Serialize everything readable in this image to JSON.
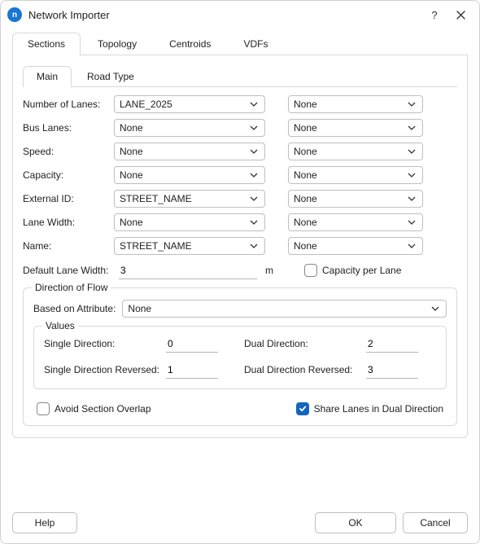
{
  "window": {
    "title": "Network Importer",
    "app_icon_letter": "n"
  },
  "tabs": {
    "items": [
      "Sections",
      "Topology",
      "Centroids",
      "VDFs"
    ],
    "active_index": 0
  },
  "subtabs": {
    "items": [
      "Main",
      "Road Type"
    ],
    "active_index": 0
  },
  "fields": [
    {
      "label": "Number of Lanes:",
      "left": "LANE_2025",
      "right": "None"
    },
    {
      "label": "Bus Lanes:",
      "left": "None",
      "right": "None"
    },
    {
      "label": "Speed:",
      "left": "None",
      "right": "None"
    },
    {
      "label": "Capacity:",
      "left": "None",
      "right": "None"
    },
    {
      "label": "External ID:",
      "left": "STREET_NAME",
      "right": "None"
    },
    {
      "label": "Lane Width:",
      "left": "None",
      "right": "None"
    },
    {
      "label": "Name:",
      "left": "STREET_NAME",
      "right": "None"
    }
  ],
  "default_lane_width": {
    "label": "Default Lane Width:",
    "value": "3",
    "unit": "m"
  },
  "capacity_per_lane": {
    "label": "Capacity per Lane",
    "checked": false
  },
  "direction_group": {
    "title": "Direction of Flow",
    "based_label": "Based on Attribute:",
    "based_value": "None",
    "values_title": "Values",
    "rows": {
      "single": {
        "label": "Single Direction:",
        "value": "0"
      },
      "dual": {
        "label": "Dual Direction:",
        "value": "2"
      },
      "single_rev": {
        "label": "Single Direction Reversed:",
        "value": "1"
      },
      "dual_rev": {
        "label": "Dual Direction Reversed:",
        "value": "3"
      }
    }
  },
  "avoid_overlap": {
    "label": "Avoid Section Overlap",
    "checked": false
  },
  "share_lanes": {
    "label": "Share Lanes in Dual Direction",
    "checked": true
  },
  "buttons": {
    "help": "Help",
    "ok": "OK",
    "cancel": "Cancel"
  }
}
